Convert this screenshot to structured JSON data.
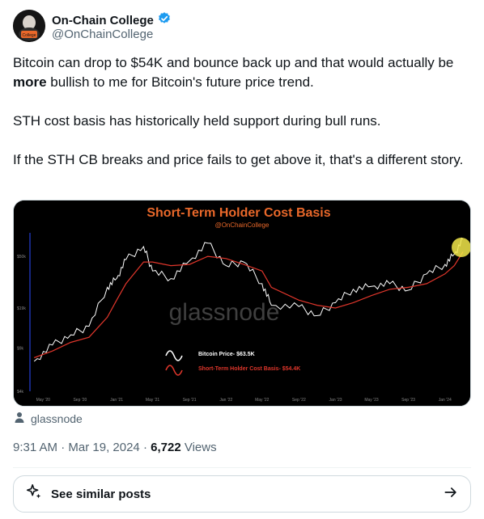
{
  "author": {
    "name": "On-Chain College",
    "handle": "@OnChainCollege",
    "verified_color": "#1d9bf0"
  },
  "tweet": {
    "paragraphs": [
      {
        "before": "Bitcoin can drop to $54K and bounce back up and that would actually be ",
        "bold": "more",
        "after": " bullish to me for Bitcoin's future price trend."
      },
      {
        "text": "STH cost basis has historically held support during bull runs."
      },
      {
        "text": "If the STH CB breaks and price fails to get above it, that's a different story."
      }
    ]
  },
  "media": {
    "source_label": "glassnode",
    "chart_data": {
      "type": "line",
      "title": "Short-Term Holder Cost Basis",
      "subtitle": "@OnChainCollege",
      "watermark": "glassnode",
      "x_ticks": [
        "May '20",
        "Sep '20",
        "Jan '21",
        "May '21",
        "Sep '21",
        "Jan '22",
        "May '22",
        "Sep '22",
        "Jan '23",
        "May '23",
        "Sep '23",
        "Jan '24"
      ],
      "y_ticks": [
        "$4k",
        "$9k",
        "$19k",
        "$50k"
      ],
      "y_scale": "log",
      "series": [
        {
          "name": "Bitcoin Price- $63.5K",
          "color": "#ffffff",
          "x": [
            "2020-04",
            "2020-06",
            "2020-08",
            "2020-10",
            "2020-12",
            "2021-01",
            "2021-02",
            "2021-04",
            "2021-05",
            "2021-07",
            "2021-09",
            "2021-11",
            "2022-01",
            "2022-03",
            "2022-05",
            "2022-06",
            "2022-09",
            "2022-11",
            "2023-01",
            "2023-03",
            "2023-05",
            "2023-07",
            "2023-09",
            "2023-11",
            "2024-01",
            "2024-02",
            "2024-03"
          ],
          "y": [
            7000,
            9500,
            11500,
            13500,
            28000,
            33000,
            47000,
            60000,
            38000,
            33000,
            46000,
            64000,
            42000,
            45000,
            30000,
            20000,
            19500,
            16500,
            21000,
            27000,
            28500,
            30000,
            26500,
            36000,
            43000,
            52000,
            69000
          ]
        },
        {
          "name": "Short-Term Holder Cost Basis- $54.4K",
          "color": "#e0362b",
          "x": [
            "2020-04",
            "2020-06",
            "2020-08",
            "2020-10",
            "2020-12",
            "2021-01",
            "2021-02",
            "2021-04",
            "2021-05",
            "2021-07",
            "2021-09",
            "2021-11",
            "2022-01",
            "2022-03",
            "2022-05",
            "2022-06",
            "2022-09",
            "2022-11",
            "2023-01",
            "2023-03",
            "2023-05",
            "2023-07",
            "2023-09",
            "2023-11",
            "2024-01",
            "2024-02",
            "2024-03"
          ],
          "y": [
            7500,
            8500,
            10000,
            11000,
            16000,
            22000,
            30000,
            45000,
            45000,
            42000,
            43000,
            50000,
            48000,
            43000,
            38000,
            28000,
            22000,
            20000,
            19000,
            21000,
            24000,
            27000,
            28000,
            30000,
            36000,
            42000,
            54400
          ]
        }
      ]
    }
  },
  "meta": {
    "time": "9:31 AM",
    "sep1": " · ",
    "date": "Mar 19, 2024",
    "sep2": " · ",
    "views_count": "6,722",
    "views_label": " Views"
  },
  "similar": {
    "label": "See similar posts",
    "icon": "sparkle-icon",
    "arrow": "arrow-right-icon"
  }
}
